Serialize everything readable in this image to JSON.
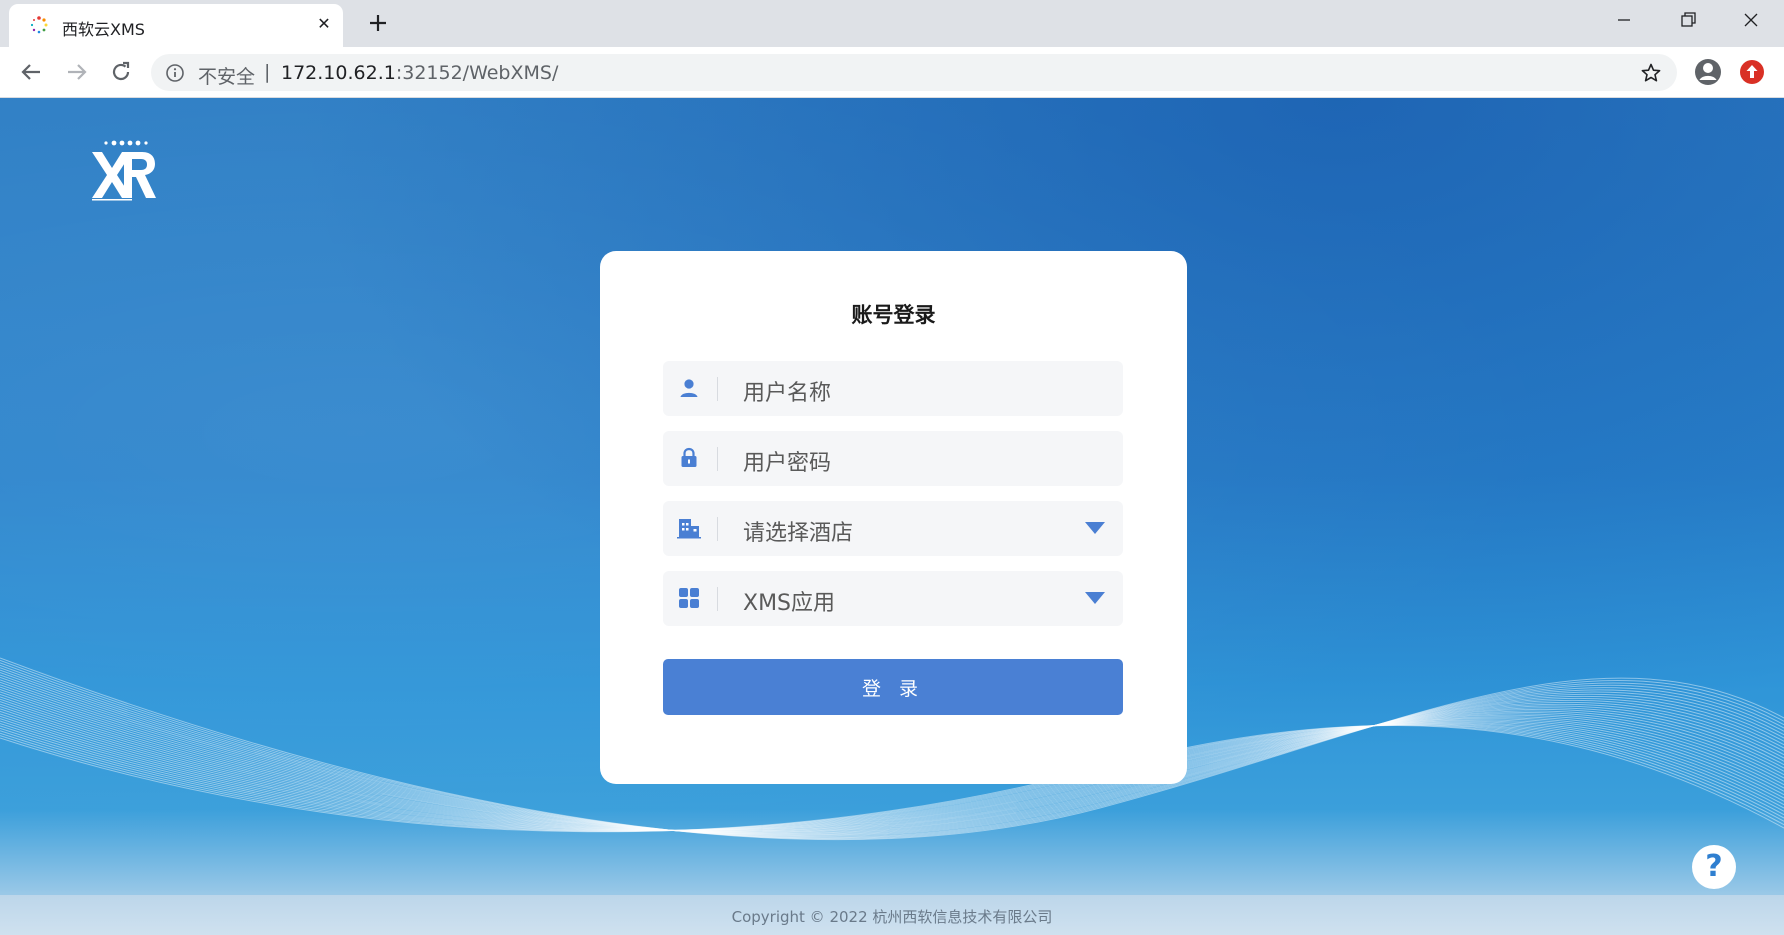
{
  "browser": {
    "tab_title": "西软云XMS",
    "tab_close": "✕",
    "insecure_label": "不安全",
    "separator": "|",
    "url_host": "172.10.62.1",
    "url_path": ":32152/WebXMS/"
  },
  "login": {
    "title": "账号登录",
    "username_placeholder": "用户名称",
    "password_placeholder": "用户密码",
    "hotel_select": "请选择酒店",
    "app_select": "XMS应用",
    "login_button": "登 录"
  },
  "footer": {
    "copyright": "Copyright © 2022 杭州西软信息技术有限公司"
  },
  "help": {
    "label": "?"
  },
  "colors": {
    "accent": "#4a80d4",
    "icon": "#4a7fd3",
    "page_bg": "#2a83cc"
  }
}
